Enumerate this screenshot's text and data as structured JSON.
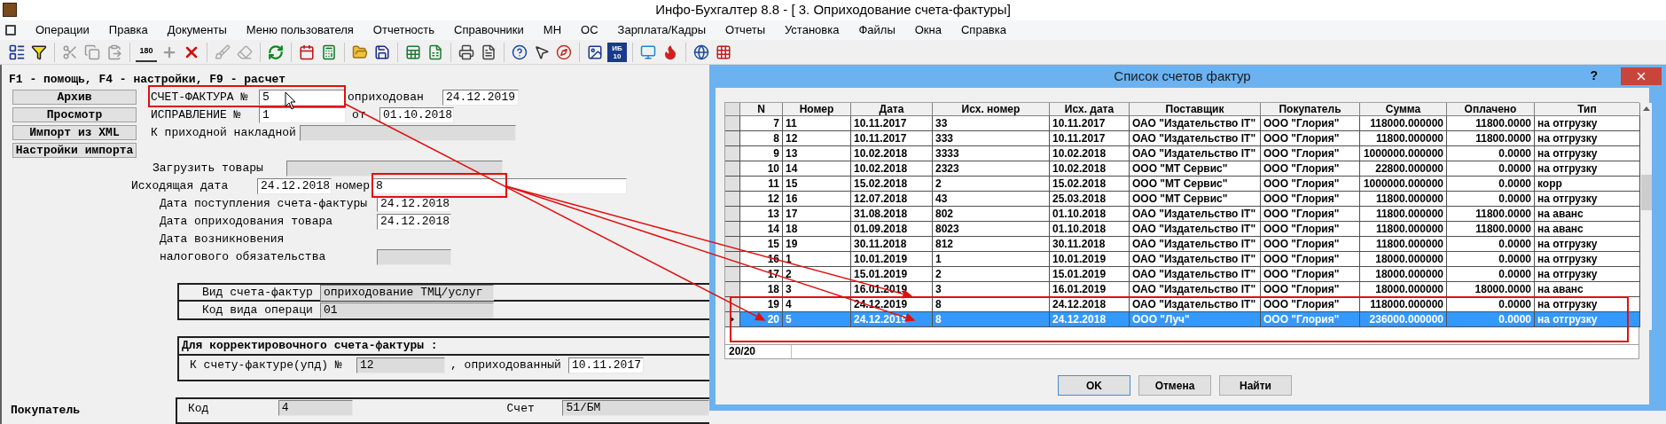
{
  "window": {
    "title": "Инфо-Бухгалтер 8.8 - [  3. Оприходование счета-фактуры]"
  },
  "menu": [
    "Операции",
    "Правка",
    "Документы",
    "Меню пользователя",
    "Отчетность",
    "Справочники",
    "МН",
    "ОС",
    "Зарплата/Кадры",
    "Отчеты",
    "Установка",
    "Файлы",
    "Окна",
    "Справка"
  ],
  "toolbar": {
    "rotate_icon_text": "180",
    "ib_icon_text": [
      "ИБ",
      "10"
    ]
  },
  "form": {
    "hint": "F1 - помощь, F4 - настройки, F9 - расчет",
    "buttons": [
      "Архив",
      "Просмотр",
      "Импорт из XML",
      "Настройки импорта"
    ],
    "invoice_label": "СЧЕТ-ФАКТУРА №",
    "invoice_number": "5",
    "posted_label": "оприходован",
    "posted_date": "24.12.2019",
    "correction_label": "ИСПРАВЛЕНИЕ  №",
    "correction_number": "1",
    "from_label": "от",
    "correction_date": "01.10.2018",
    "receipt_label": "К приходной накладной",
    "load_label": "Загрузить товары",
    "outgoing_date_label": "Исходящая дата",
    "outgoing_date": "24.12.2018",
    "number_label": "номер",
    "outgoing_number": "8",
    "dates": [
      {
        "label": "Дата поступления счета-фактуры",
        "value": "24.12.2018"
      },
      {
        "label": "Дата оприходования товара",
        "value": "24.12.2018"
      }
    ],
    "tax_label_1": "Дата возникновения",
    "tax_label_2": "налогового обязательства",
    "invoice_type_label": "Вид счета-фактур",
    "invoice_type": "оприходование ТМЦ/услуг",
    "operation_label": "Код вида операци",
    "operation_code": "01",
    "correction_section": {
      "title": "Для корректировочного счета-фактуры :",
      "ref_label": "К счету-фактуре(упд)  №",
      "ref_number": "12",
      "ref_posted_label": ", оприходованный",
      "ref_date": "10.11.2017"
    },
    "buyer": {
      "label": "Покупатель",
      "code_label": "Код",
      "code": "4",
      "account_label": "Счет",
      "account": "51/БМ"
    }
  },
  "dialog": {
    "title": "Список счетов фактур",
    "help": "?",
    "columns": [
      "N",
      "Номер",
      "Дата",
      "Исх. номер",
      "Исх. дата",
      "Поставщик",
      "Покупатель",
      "Сумма",
      "Оплачено",
      "Тип"
    ],
    "rows": [
      {
        "cells": [
          "7",
          "11",
          "10.11.2017",
          "33",
          "10.11.2017",
          "ОАО \"Издательство IT\"",
          "ООО \"Глория\"",
          "118000.000000",
          "11800.0000",
          "на отгрузку"
        ],
        "selected": false
      },
      {
        "cells": [
          "8",
          "12",
          "10.11.2017",
          "333",
          "10.11.2017",
          "ОАО \"Издательство IT\"",
          "ООО \"Глория\"",
          "11800.000000",
          "11800.0000",
          "на отгрузку"
        ],
        "selected": false
      },
      {
        "cells": [
          "9",
          "13",
          "10.02.2018",
          "3333",
          "10.02.2018",
          "ОАО \"Издательство IT\"",
          "ООО \"Глория\"",
          "1000000.000000",
          "0.0000",
          "на отгрузку"
        ],
        "selected": false
      },
      {
        "cells": [
          "10",
          "14",
          "10.02.2018",
          "2323",
          "10.02.2018",
          "ООО \"МТ Сервис\"",
          "ООО \"Глория\"",
          "22800.000000",
          "0.0000",
          "на отгрузку"
        ],
        "selected": false
      },
      {
        "cells": [
          "11",
          "15",
          "15.02.2018",
          "2",
          "15.02.2018",
          "ООО \"МТ Сервис\"",
          "ООО \"Глория\"",
          "1000000.000000",
          "0.0000",
          "корр"
        ],
        "selected": false
      },
      {
        "cells": [
          "12",
          "16",
          "12.07.2018",
          "43",
          "25.03.2018",
          "ООО \"МТ Сервис\"",
          "ООО \"Глория\"",
          "11800.000000",
          "0.0000",
          "на отгрузку"
        ],
        "selected": false
      },
      {
        "cells": [
          "13",
          "17",
          "31.08.2018",
          "802",
          "01.10.2018",
          "ОАО \"Издательство IT\"",
          "ООО \"Глория\"",
          "11800.000000",
          "11800.0000",
          "на аванс"
        ],
        "selected": false
      },
      {
        "cells": [
          "14",
          "18",
          "01.09.2018",
          "8023",
          "01.10.2018",
          "ОАО \"Издательство IT\"",
          "ООО \"Глория\"",
          "11800.000000",
          "11800.0000",
          "на аванс"
        ],
        "selected": false
      },
      {
        "cells": [
          "15",
          "19",
          "30.11.2018",
          "812",
          "30.11.2018",
          "ОАО \"Издательство IT\"",
          "ООО \"Глория\"",
          "11800.000000",
          "0.0000",
          "на отгрузку"
        ],
        "selected": false
      },
      {
        "cells": [
          "16",
          "1",
          "10.01.2019",
          "1",
          "10.01.2019",
          "ОАО \"Издательство IT\"",
          "ООО \"Глория\"",
          "18000.000000",
          "0.0000",
          "на отгрузку"
        ],
        "selected": false
      },
      {
        "cells": [
          "17",
          "2",
          "15.01.2019",
          "2",
          "15.01.2019",
          "ОАО \"Издательство IT\"",
          "ООО \"Глория\"",
          "18000.000000",
          "0.0000",
          "на отгрузку"
        ],
        "selected": false
      },
      {
        "cells": [
          "18",
          "3",
          "16.01.2019",
          "3",
          "16.01.2019",
          "ОАО \"Издательство IT\"",
          "ООО \"Глория\"",
          "18000.000000",
          "18000.0000",
          "на аванс"
        ],
        "selected": false
      },
      {
        "cells": [
          "19",
          "4",
          "24.12.2019",
          "8",
          "24.12.2018",
          "ОАО \"Издательство IT\"",
          "ООО \"Глория\"",
          "118000.000000",
          "0.0000",
          "на отгрузку"
        ],
        "selected": false
      },
      {
        "cells": [
          "20",
          "5",
          "24.12.2019",
          "8",
          "24.12.2018",
          "ООО \"Луч\"",
          "ООО \"Глория\"",
          "236000.000000",
          "0.0000",
          "на отгрузку"
        ],
        "selected": true
      }
    ],
    "counter": "20/20",
    "buttons": [
      {
        "label": "OK",
        "default": true
      },
      {
        "label": "Отмена",
        "default": false
      },
      {
        "label": "Найти",
        "default": false
      }
    ]
  }
}
